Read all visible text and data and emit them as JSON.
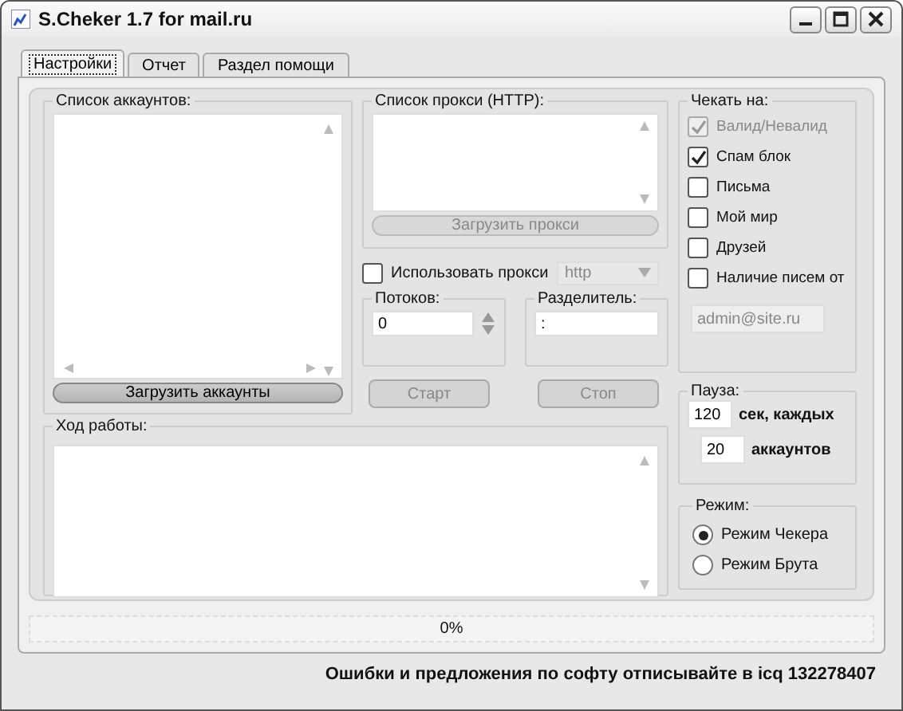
{
  "window": {
    "title": "S.Cheker 1.7 for mail.ru"
  },
  "tabs": [
    {
      "label": "Настройки",
      "selected": true
    },
    {
      "label": "Отчет",
      "selected": false
    },
    {
      "label": "Раздел помощи",
      "selected": false
    }
  ],
  "accounts": {
    "legend": "Список аккаунтов:",
    "button": "Загрузить аккаунты",
    "button_disabled": false
  },
  "proxy": {
    "legend": "Список прокси (HTTP):",
    "button": "Загрузить прокси",
    "button_disabled": true
  },
  "use_proxy": {
    "label": "Использовать прокси",
    "checked": false
  },
  "proxy_type": {
    "value": "http",
    "disabled": true
  },
  "threads": {
    "legend": "Потоков:",
    "value": "0"
  },
  "separator": {
    "legend": "Разделитель:",
    "value": ":"
  },
  "actions": [
    {
      "label": "Старт",
      "disabled": true
    },
    {
      "label": "Стоп",
      "disabled": true
    }
  ],
  "check_on": {
    "legend": "Чекать на:",
    "options": [
      {
        "label": "Валид/Невалид",
        "checked": true,
        "disabled": true
      },
      {
        "label": "Спам блок",
        "checked": true,
        "disabled": false
      },
      {
        "label": "Письма",
        "checked": false,
        "disabled": false
      },
      {
        "label": "Мой мир",
        "checked": false,
        "disabled": false
      },
      {
        "label": "Друзей",
        "checked": false,
        "disabled": false
      },
      {
        "label": "Наличие писем от",
        "checked": false,
        "disabled": false
      }
    ],
    "sender": {
      "value": "admin@site.ru",
      "disabled": true
    }
  },
  "pause": {
    "legend": "Пауза:",
    "seconds": "120",
    "seconds_label": "сек, каждых",
    "accounts": "20",
    "accounts_label": "аккаунтов"
  },
  "mode": {
    "legend": "Режим:",
    "options": [
      {
        "label": "Режим Чекера",
        "selected": true
      },
      {
        "label": "Режим Брута",
        "selected": false
      }
    ]
  },
  "log": {
    "legend": "Ход работы:"
  },
  "progress": {
    "text": "0%",
    "level": 0
  },
  "footer": "Ошибки и предложения по софту отписывайте в icq 132278407"
}
